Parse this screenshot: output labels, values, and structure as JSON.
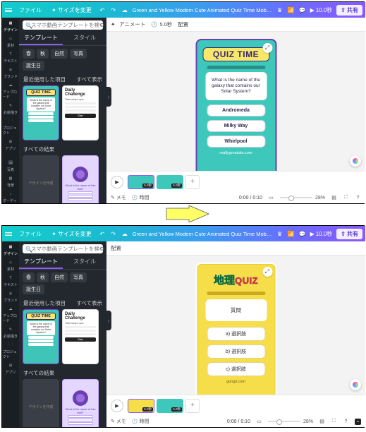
{
  "topbar": {
    "file": "ファイル",
    "resize": "サイズを変更",
    "title": "Green and Yellow Modern Cute Animated Quiz Time Mobile ...",
    "duration": "10.0秒",
    "share": "共有"
  },
  "search": {
    "placeholder": "スマホ動画テンプレートを検索"
  },
  "tabs": {
    "templates": "テンプレート",
    "style": "スタイル"
  },
  "chips": [
    "春",
    "秋",
    "自然",
    "写真",
    "誕生日"
  ],
  "sections": {
    "recent": "最近使用した項目",
    "see_all": "すべて表示",
    "all_results": "すべての結果"
  },
  "rail": {
    "design": "デザイン",
    "elements": "素材",
    "text": "テキスト",
    "brand": "ブランド",
    "upload": "アップロード",
    "draw": "お絵描き",
    "projects": "プロジェクト",
    "apps": "アプリ",
    "photo": "写真",
    "bg": "背景",
    "audio": "オーディオ"
  },
  "cards": {
    "quiz_title": "QUIZ TIME",
    "quiz_q": "What is the name of the galaxy that contains our Solar System?",
    "dc_title": "Daily Challenge",
    "dc_sub": "Take today's quiz",
    "dc_cta": "Start",
    "gray": "デザインを作成",
    "purple_q": "What is the name of this fruit?"
  },
  "canvas_toolbar": {
    "animate": "アニメート",
    "dur": "5.0秒",
    "position": "配置"
  },
  "page_green": {
    "title": "QUIZ TIME",
    "question": "What is the name of the galaxy that contains our Solar System?",
    "opts": [
      "Andromeda",
      "Milky Way",
      "Whirlpool"
    ],
    "footer": "reallygreatsite.com"
  },
  "page_yellow": {
    "title_jp": "地理",
    "title_en": "QUIZ",
    "question": "質問",
    "opts": [
      "a) 選択肢",
      "b) 選択肢",
      "c) 選択肢"
    ],
    "footer": "gungii.com"
  },
  "timeline": {
    "clip_dur": "5.0秒"
  },
  "bottombar": {
    "memo": "メモ",
    "duration_toggle": "時間",
    "time": "0:00 / 0:10",
    "zoom": "28%"
  }
}
